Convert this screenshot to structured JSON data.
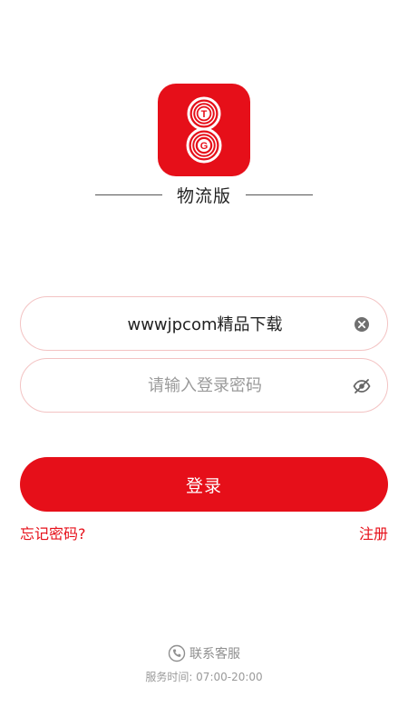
{
  "brand": {
    "icon": "8-tg-logo-icon",
    "accent_color": "#e60f19",
    "subtitle": "物流版"
  },
  "login_form": {
    "username_value": "wwwjpcom精品下载",
    "username_clear_icon": "clear-circle-icon",
    "password_placeholder": "请输入登录密码",
    "password_toggle_icon": "eye-off-icon",
    "submit_label": "登录"
  },
  "links": {
    "forgot_password": "忘记密码?",
    "register": "注册"
  },
  "support": {
    "icon": "phone-icon",
    "label": "联系客服",
    "hours": "服务时间: 07:00-20:00"
  }
}
